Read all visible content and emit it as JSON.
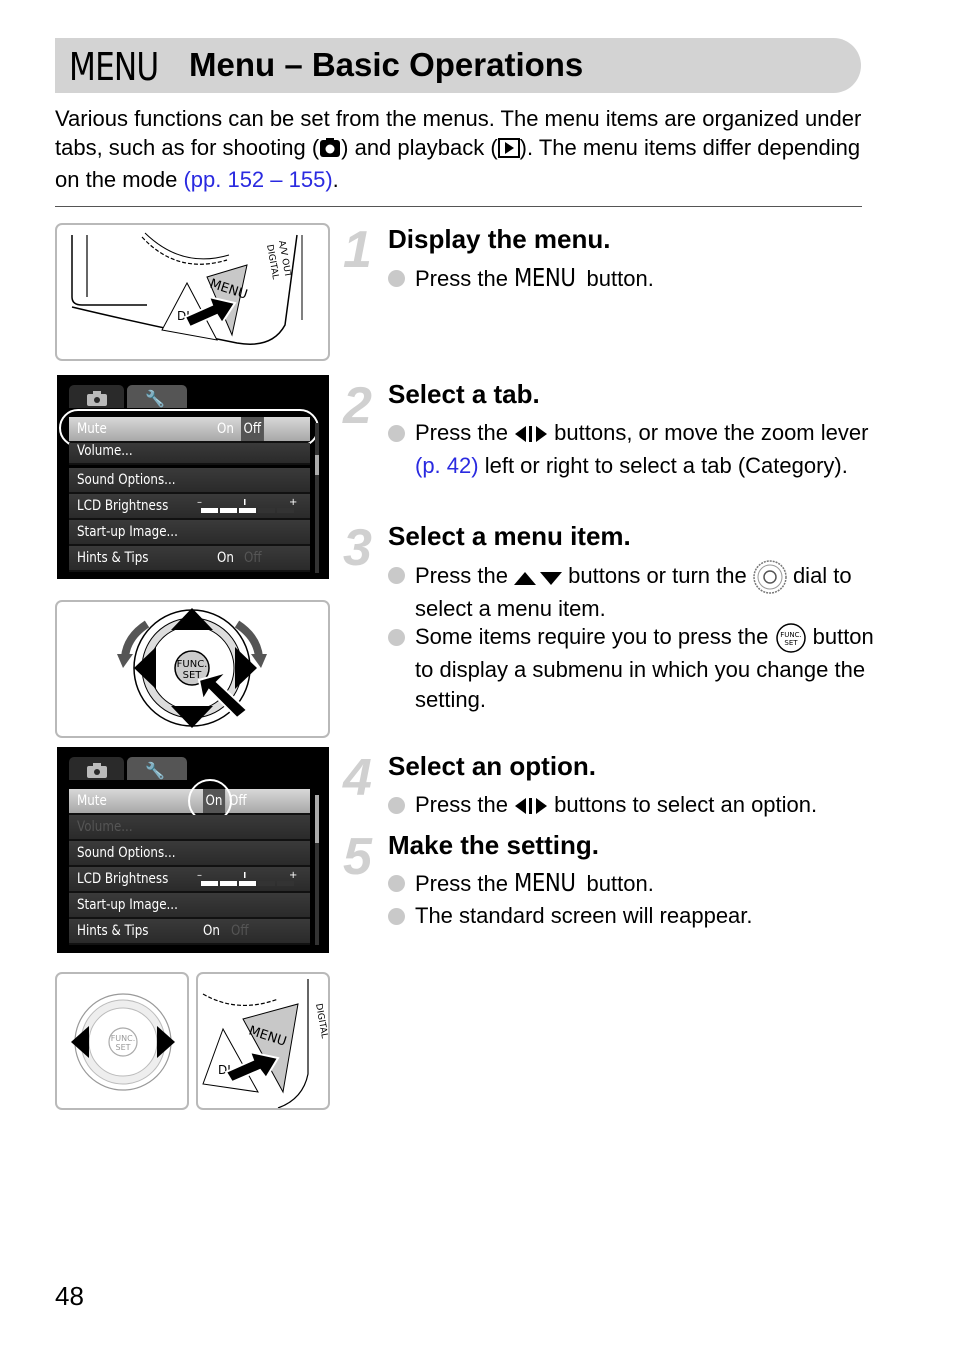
{
  "header": {
    "menu_glyph": "MENU",
    "title": "Menu – Basic Operations"
  },
  "intro": {
    "part1": "Various functions can be set from the menus. The menu items are organized under tabs, such as for shooting (",
    "shooting_icon": "camera-icon",
    "part2": ") and playback (",
    "playback_icon": "play-icon",
    "part3": "). The menu items differ depending on the mode ",
    "link": "(pp. 152 – 155)",
    "part4": "."
  },
  "steps": [
    {
      "number": "1",
      "title": "Display the menu.",
      "bullets": [
        {
          "pre": "Press the ",
          "menu": "MENU",
          "post": " button."
        }
      ]
    },
    {
      "number": "2",
      "title": "Select a tab.",
      "bullets": [
        {
          "pre": "Press the ",
          "icon": "left-right-arrows-icon",
          "mid": " buttons, or move the zoom lever ",
          "link": "(p. 42)",
          "post": " left or right to select a tab (Category)."
        }
      ]
    },
    {
      "number": "3",
      "title": "Select a menu item.",
      "bullets": [
        {
          "pre": "Press the ",
          "icon": "up-down-arrows-icon",
          "mid": " buttons or turn the ",
          "icon2": "control-dial-icon",
          "post": " dial to select a menu item."
        },
        {
          "pre": "Some items require you to press the ",
          "icon": "func-set-icon",
          "post": " button to display a submenu in which you change the setting."
        }
      ]
    },
    {
      "number": "4",
      "title": "Select an option.",
      "bullets": [
        {
          "pre": "Press the ",
          "icon": "left-right-arrows-icon",
          "post": " buttons to select an option."
        }
      ]
    },
    {
      "number": "5",
      "title": "Make the setting.",
      "bullets": [
        {
          "pre": "Press the ",
          "menu": "MENU",
          "post": " button."
        },
        {
          "text": "The standard screen will reappear."
        }
      ]
    }
  ],
  "illustrations": {
    "camera_button": {
      "menu_label": "MENU",
      "disp_label": "DI",
      "side_label_1": "A/V OUT",
      "side_label_2": "DIGITAL"
    },
    "dial": {
      "center_label_1": "FUNC.",
      "center_label_2": "SET"
    },
    "screen_a": {
      "tabs": [
        "camera-tab-icon",
        "settings-tab-icon"
      ],
      "rows": [
        {
          "label": "Mute",
          "opt1": "On",
          "opt2": "Off",
          "selected": "Off"
        },
        {
          "label": "Volume..."
        },
        {
          "label": "Sound Options..."
        },
        {
          "label": "LCD Brightness",
          "level_fraction": 0.5
        },
        {
          "label": "Start-up Image..."
        },
        {
          "label": "Hints & Tips",
          "opt1": "On",
          "opt2": "Off"
        }
      ]
    },
    "screen_b": {
      "rows": [
        {
          "label": "Mute",
          "opt1": "On",
          "opt2": "Off",
          "selected": "On"
        },
        {
          "label": "Volume..."
        },
        {
          "label": "Sound Options..."
        },
        {
          "label": "LCD Brightness",
          "level_fraction": 0.5
        },
        {
          "label": "Start-up Image..."
        },
        {
          "label": "Hints & Tips",
          "opt1": "On",
          "opt2": "Off"
        }
      ]
    }
  },
  "page_number": "48",
  "colors": {
    "link": "#2a2ae0",
    "title_bar": "#d3d3d3",
    "step_number": "#d0d0d0"
  }
}
